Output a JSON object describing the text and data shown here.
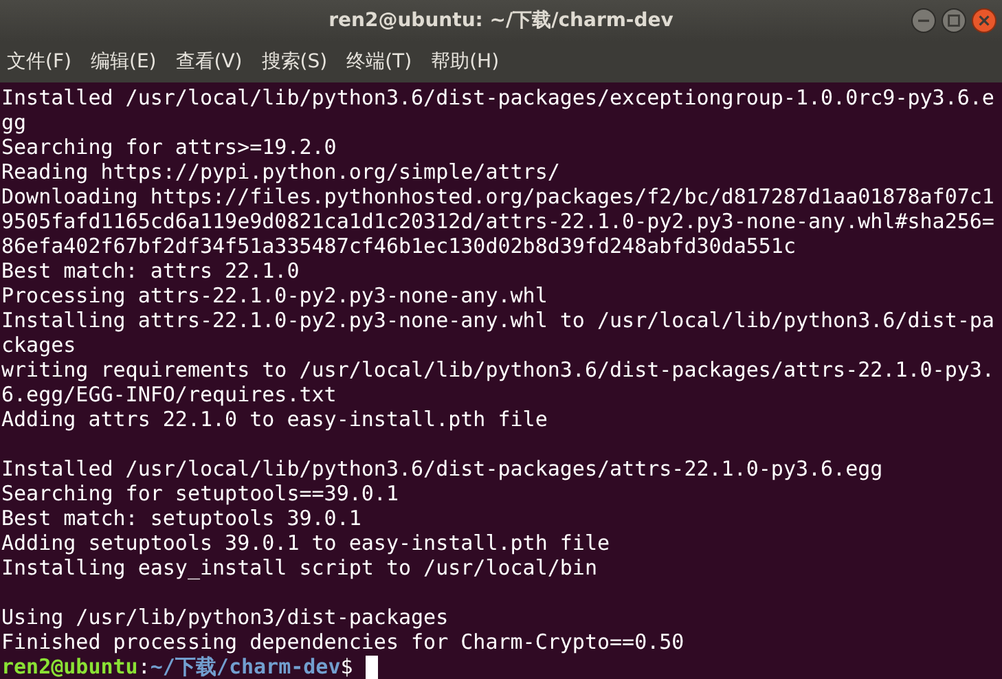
{
  "window": {
    "title": "ren2@ubuntu: ~/下载/charm-dev"
  },
  "menu": [
    "文件(F)",
    "编辑(E)",
    "查看(V)",
    "搜索(S)",
    "终端(T)",
    "帮助(H)"
  ],
  "lines": [
    {
      "kind": "output",
      "text": "Installed /usr/local/lib/python3.6/dist-packages/exceptiongroup-1.0.0rc9-py3.6.e"
    },
    {
      "kind": "output",
      "text": "gg"
    },
    {
      "kind": "output",
      "text": "Searching for attrs>=19.2.0"
    },
    {
      "kind": "output",
      "text": "Reading https://pypi.python.org/simple/attrs/"
    },
    {
      "kind": "output",
      "text": "Downloading https://files.pythonhosted.org/packages/f2/bc/d817287d1aa01878af07c1"
    },
    {
      "kind": "output",
      "text": "9505fafd1165cd6a119e9d0821ca1d1c20312d/attrs-22.1.0-py2.py3-none-any.whl#sha256="
    },
    {
      "kind": "output",
      "text": "86efa402f67bf2df34f51a335487cf46b1ec130d02b8d39fd248abfd30da551c"
    },
    {
      "kind": "output",
      "text": "Best match: attrs 22.1.0"
    },
    {
      "kind": "output",
      "text": "Processing attrs-22.1.0-py2.py3-none-any.whl"
    },
    {
      "kind": "output",
      "text": "Installing attrs-22.1.0-py2.py3-none-any.whl to /usr/local/lib/python3.6/dist-pa"
    },
    {
      "kind": "output",
      "text": "ckages"
    },
    {
      "kind": "output",
      "text": "writing requirements to /usr/local/lib/python3.6/dist-packages/attrs-22.1.0-py3."
    },
    {
      "kind": "output",
      "text": "6.egg/EGG-INFO/requires.txt"
    },
    {
      "kind": "output",
      "text": "Adding attrs 22.1.0 to easy-install.pth file"
    },
    {
      "kind": "blank"
    },
    {
      "kind": "output",
      "text": "Installed /usr/local/lib/python3.6/dist-packages/attrs-22.1.0-py3.6.egg"
    },
    {
      "kind": "output",
      "text": "Searching for setuptools==39.0.1"
    },
    {
      "kind": "output",
      "text": "Best match: setuptools 39.0.1"
    },
    {
      "kind": "output",
      "text": "Adding setuptools 39.0.1 to easy-install.pth file"
    },
    {
      "kind": "output",
      "text": "Installing easy_install script to /usr/local/bin"
    },
    {
      "kind": "blank"
    },
    {
      "kind": "output",
      "text": "Using /usr/lib/python3/dist-packages"
    },
    {
      "kind": "output",
      "text": "Finished processing dependencies for Charm-Crypto==0.50"
    }
  ],
  "prompt": {
    "user_host": "ren2@ubuntu",
    "separator": ":",
    "path": "~/下载/charm-dev",
    "symbol": "$"
  }
}
